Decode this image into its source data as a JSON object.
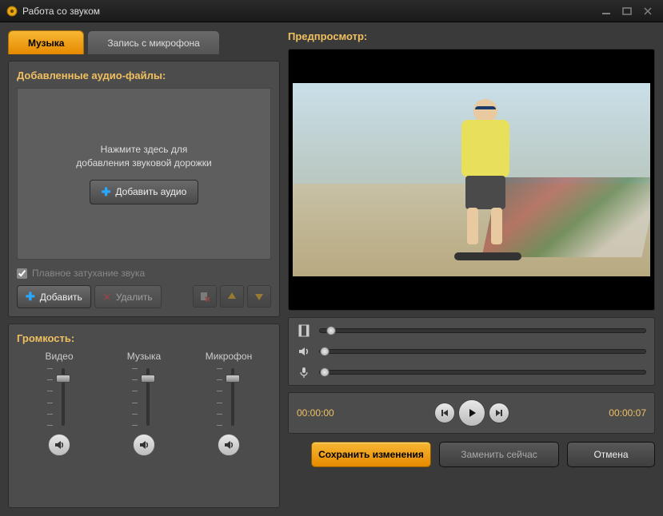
{
  "window": {
    "title": "Работа со звуком"
  },
  "tabs": {
    "music": "Музыка",
    "mic": "Запись с микрофона"
  },
  "files": {
    "heading": "Добавленные аудио-файлы:",
    "hint_line1": "Нажмите здесь для",
    "hint_line2": "добавления звуковой дорожки",
    "add_audio_btn": "Добавить аудио",
    "fade_label": "Плавное затухание звука",
    "fade_checked": true,
    "toolbar": {
      "add": "Добавить",
      "delete": "Удалить"
    }
  },
  "volume": {
    "heading": "Громкость:",
    "channels": {
      "video": {
        "label": "Видео",
        "level": 0.82
      },
      "music": {
        "label": "Музыка",
        "level": 0.82
      },
      "mic": {
        "label": "Микрофон",
        "level": 0.82
      }
    }
  },
  "preview": {
    "heading": "Предпросмотр:"
  },
  "tracks": {
    "video_pos": 0.03,
    "audio_pos": 0.0,
    "mic_pos": 0.0
  },
  "transport": {
    "current": "00:00:00",
    "total": "00:00:07"
  },
  "actions": {
    "save": "Сохранить изменения",
    "replace": "Заменить сейчас",
    "cancel": "Отмена"
  }
}
